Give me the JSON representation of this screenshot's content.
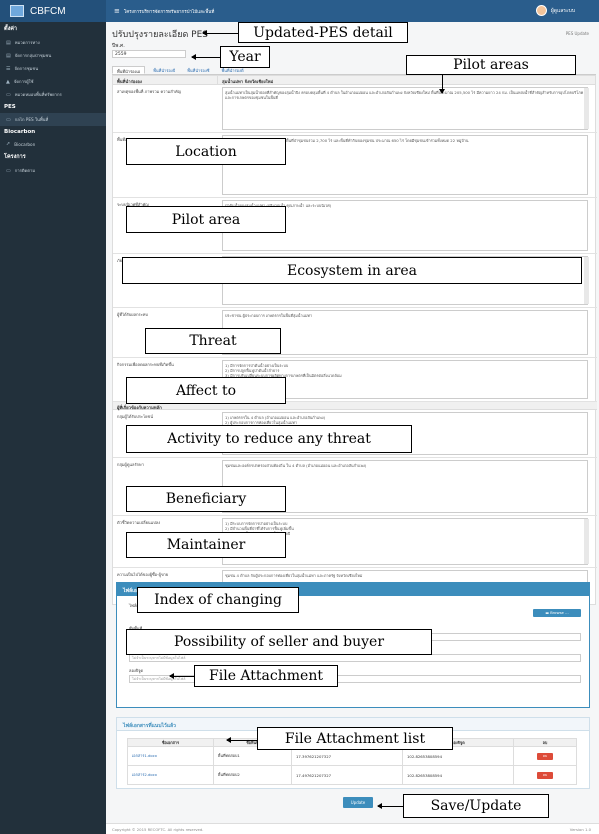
{
  "app": {
    "brand": "CBFCM",
    "breadcrumb": "โครงการบริหารจัดการทรัพยากรป่าไม้และพื้นที่",
    "user_name": "ผู้ดูแลระบบ"
  },
  "sidebar": {
    "sections": [
      {
        "title": "ตั้งค่า",
        "items": [
          "หมวดการทาง",
          "จัดการกลุ่มป่าชุมชน",
          "จัดการชุมชน",
          "จัดการผู้ใช้",
          "หมวดหมอบพื้นที่ทรัพยากร"
        ]
      },
      {
        "title": "PES",
        "items": [
          "กลไก PES ในพื้นที่"
        ]
      },
      {
        "title": "Biocarbon",
        "items": [
          "Biocarbon"
        ]
      },
      {
        "title": "โครงการ",
        "items": [
          "การติดตาม"
        ]
      }
    ]
  },
  "page": {
    "title": "ปรับปรุงรายละเอียด PES",
    "crumb": "PES  Update",
    "year_label": "ปีพ.ศ.",
    "year_value": "2559",
    "tabs": [
      "พื้นที่นำร่องเอ",
      "พื้นที่นำร่องบี",
      "พื้นที่นำร่องซี",
      "พื้นที่นำร่องดี"
    ]
  },
  "detail": {
    "col1": "พื้นที่นำร่ององ",
    "col2": "ลุ่มน้ำแม่ทา จังหวัดเชียงใหม่",
    "rows": [
      {
        "label": "สาเหตุของพื้นที่ ภาพรวม ความสำคัญ",
        "text": "ลุ่มน้ำแม่ทาเป็นลุ่มน้ำย่อยที่สำคัญของลุ่มน้ำปิง ครอบคลุมพื้นที่ 4 ตำบล ในอำเภอแม่ออน และอำเภอสันกำแพง จังหวัดเชียงใหม่ พื้นที่ประมาณ 205,500 ไร่ มีความยาว 24 กม. เป็นแหล่งน้ำที่สำคัญสำหรับการอุปโภคบริโภคและการเกษตรของชุมชนในพื้นที่"
      },
      {
        "label": "พื้นที่ส่วนตน",
        "text": "ป่าชุมชนของหมู่บ้านในลุ่มน้ำแม่ทา มีพื้นที่ป่าชุมชนรวม 2,700 ไร่ และพื้นที่ทำกินของชุมชน ประมาณ 650 ไร่ โดยมีชุมชนเข้าร่วมทั้งหมด 22 หมู่บ้าน"
      },
      {
        "label": "ระบบนิเวศที่สำคัญ",
        "text": "ป่าต้นน้ำของลุ่มน้ำแม่ทา (ปริมาณน้ำ คุณภาพน้ำ และระบบนิเวศ)"
      },
      {
        "label": "ภัยคุกคามและผลกระทบที่เกิดขึ้นกับระบบนิเวศในพื้นที่",
        "text": "1) ป่าต้นน้ำเสื่อมโทรม จากการเปลี่ยนแปลงการใช้ที่ดิน\n2) ขาดแคลนน้ำ จากการใช้น้ำในภาคการเกษตร\n3) คุณภาพน้ำเสื่อมโทรม จากสารเคมีการเกษตร"
      },
      {
        "label": "ผู้ที่ได้รับผลกระทบ",
        "text": "ประชาชน ผู้ประกอบการ เกษตรกรในพื้นที่ลุ่มน้ำแม่ทา"
      },
      {
        "label": "กิจกรรมเพื่อลดผลกระทบที่เกิดขึ้น",
        "text": "1) มีการจัดการป่าต้นน้ำอย่างเป็นระบบ\n2) มีการปลูกฟื้นฟูป่าต้นน้ำลำธาร\n3) มีการปรับเปลี่ยนระบบการผลิตทางการเกษตรที่เป็นมิตรต่อสิ่งแวดล้อม"
      },
      {
        "label": "กลุ่มผู้ได้รับประโยชน์",
        "text": "1) เกษตรกรใน 4 ตำบล (อำเภอแม่ออน และอำเภอสันกำแพง)\n2) ผู้ประกอบการการท่องเที่ยวในลุ่มน้ำแม่ทา"
      },
      {
        "label": "กลุ่มผู้ดูแลรักษา",
        "text": "ชุมชนและองค์กรปกครองส่วนท้องถิ่น ใน 4 ตำบล (อำเภอแม่ออน และอำเภอสันกำแพง)"
      },
      {
        "label": "ตัวชี้วัดความเปลี่ยนแปลง",
        "text": "1) มีระบบการจัดการป่าอย่างเป็นระบบ\n2) มีจำนวนพื้นที่ป่าที่ได้รับการฟื้นฟูเพิ่มขึ้น\n3) มีปริมาณน้ำเพียงพอต่อการใช้ตลอดปี"
      },
      {
        "label": "ความเป็นไปได้ของผู้ซื้อ-ผู้ขาย",
        "text": "ชุมชน 4 ตำบล กับผู้ประกอบการท่องเที่ยวในลุ่มน้ำแม่ทา และภาครัฐ จังหวัดเชียงใหม่"
      }
    ],
    "section_bar": "ผู้ที่เกี่ยวข้องกับความหลัก"
  },
  "attach": {
    "title": "ไฟล์เอกสาร",
    "file_label": "ไฟล์เอกสาร",
    "browse": "Browse ...",
    "fields": [
      {
        "label": "ชื่อพื้นที่",
        "placeholder": "ไม่จำเป็นระบุหากไม่มีข้อมูลในไฟล์"
      },
      {
        "label": "ละติจูด",
        "placeholder": "ไม่จำเป็นระบุหากไม่มีข้อมูลในไฟล์"
      },
      {
        "label": "ลองจิจูด",
        "placeholder": "ไม่จำเป็นระบุหากไม่มีข้อมูลในไฟล์"
      }
    ]
  },
  "file_list": {
    "title": "ไฟล์เอกสารที่แนบไว้แล้ว",
    "headers": [
      "ชื่อเอกสาร",
      "ชื่อพื้นที่",
      "ละติจูด",
      "ลองจิจูด",
      "ลบ"
    ],
    "rows": [
      {
        "name": "เอกสาร1.docx",
        "area": "พื้นที่ทดสอบ1",
        "lat": "17.397621207327",
        "lng": "102.82653808594",
        "del": "ลบ"
      },
      {
        "name": "เอกสาร2.docx",
        "area": "พื้นที่ทดสอบ2",
        "lat": "17.497621207327",
        "lng": "102.82653808594",
        "del": "ลบ"
      }
    ]
  },
  "update_label": "Update",
  "footer": {
    "copyright": "Copyright © 2015 RECOFTC. All rights reserved.",
    "version": "Version 1.0"
  },
  "callouts": {
    "updated_pes": "Updated-PES detail",
    "year": "Year",
    "pilot_areas": "Pilot areas",
    "location": "Location",
    "pilot_area": "Pilot area",
    "ecosystem": "Ecosystem in area",
    "threat": "Threat",
    "affect": "Affect to",
    "activity": "Activity to reduce any threat",
    "beneficiary": "Beneficiary",
    "maintainer": "Maintainer",
    "index": "Index of changing",
    "possibility": "Possibility of seller and buyer",
    "file_attachment": "File Attachment",
    "file_attachment_list": "File Attachment list",
    "save_update": "Save/Update"
  }
}
